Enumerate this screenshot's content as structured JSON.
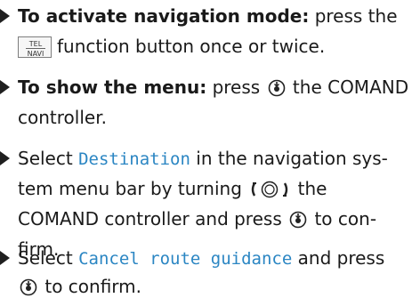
{
  "steps": [
    {
      "lead": "To activate navigation mode:",
      "lines": [
        "press the",
        "function button once or twice."
      ],
      "key": {
        "top": "TEL",
        "bottom": "NAVI"
      }
    },
    {
      "lead": "To show the menu:",
      "lines": [
        "press",
        "the COMAND",
        "controller."
      ]
    },
    {
      "lines": [
        "Select",
        "Destination",
        "in the navigation sys-",
        "tem menu bar by turning",
        "the",
        "COMAND controller and press",
        "to con-",
        "firm."
      ]
    },
    {
      "lines": [
        "Select",
        "Cancel route guidance",
        "and press",
        "to confirm."
      ]
    }
  ],
  "icons": {
    "press": "controller-press-icon",
    "turn": "controller-turn-icon"
  }
}
